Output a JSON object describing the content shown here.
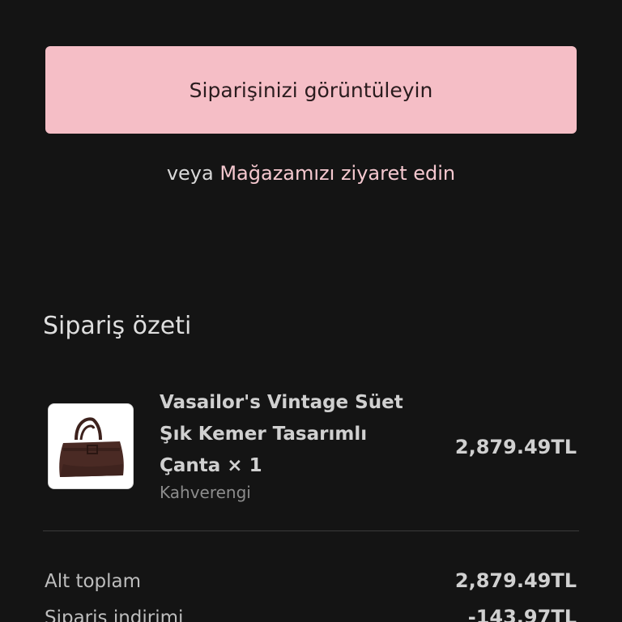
{
  "actions": {
    "view_order_label": "Siparişinizi görüntüleyin",
    "or_text": "veya ",
    "visit_store_link": "Mağazamızı ziyaret edin"
  },
  "summary": {
    "title": "Sipariş özeti",
    "item": {
      "name_line1": "Vasailor's Vintage Süet",
      "name_line2": "Şık Kemer Tasarımlı",
      "name_line3": "Çanta × 1",
      "variant": "Kahverengi",
      "price": "2,879.49TL",
      "image_icon": "handbag-icon"
    },
    "rows": [
      {
        "label": "Alt toplam",
        "value": "2,879.49TL"
      },
      {
        "label": "Sipariş indirimi",
        "value": "-143.97TL"
      }
    ]
  },
  "colors": {
    "background": "#141414",
    "button": "#f5bec6",
    "link": "#f5c8cf",
    "bag": "#4a2a24"
  }
}
